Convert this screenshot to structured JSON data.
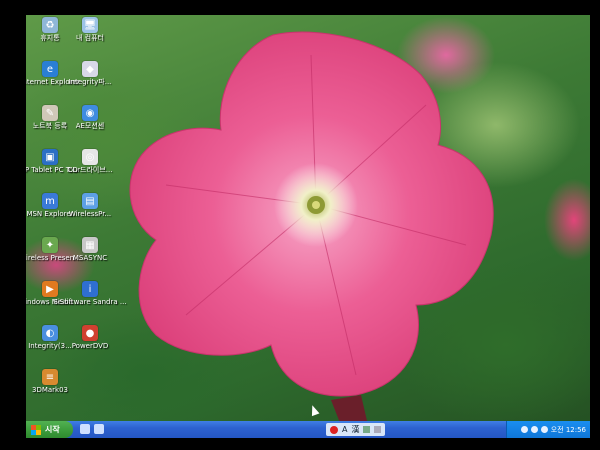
{
  "desktop": {
    "icons": [
      {
        "label": "휴지통",
        "icon": "recycle-bin-icon",
        "color": "#8fb7d8"
      },
      {
        "label": "내 컴퓨터",
        "icon": "my-computer-icon",
        "color": "#9cc3e6"
      },
      {
        "label": "Internet Explorer",
        "icon": "internet-explorer-icon",
        "color": "#2a7fd4"
      },
      {
        "label": "Integrity파...",
        "icon": "integrity-file-icon",
        "color": "#d8d8e8"
      },
      {
        "label": "노트북 등록",
        "icon": "notebook-register-icon",
        "color": "#d0c8b8"
      },
      {
        "label": "AE모션센",
        "icon": "ae-motion-sensor-icon",
        "color": "#3f8ce0"
      },
      {
        "label": "HP Tablet PC Tour",
        "icon": "hp-tablet-tour-icon",
        "color": "#2b6fc4"
      },
      {
        "label": "CD 드라이브...",
        "icon": "cd-drive-icon",
        "color": "#e6e6e6"
      },
      {
        "label": "MSN Explorer",
        "icon": "msn-explorer-icon",
        "color": "#3a7ad8"
      },
      {
        "label": "WirelessPr...",
        "icon": "wireless-pro-icon",
        "color": "#5da0e6"
      },
      {
        "label": "Wireless Presen...",
        "icon": "wireless-presentation-icon",
        "color": "#6aa84f"
      },
      {
        "label": "MSASYNC",
        "icon": "msasync-icon",
        "color": "#c8c8c8"
      },
      {
        "label": "Windows Media ...",
        "icon": "windows-media-icon",
        "color": "#e07a20"
      },
      {
        "label": "SiSoftware Sandra ...",
        "icon": "sisoftware-sandra-icon",
        "color": "#2f6fd0"
      },
      {
        "label": "Integrity(3...",
        "icon": "integrity-icon",
        "color": "#4a8fe0"
      },
      {
        "label": "PowerDVD",
        "icon": "powerdvd-icon",
        "color": "#d04030"
      },
      {
        "label": "3DMark03",
        "icon": "3dmark-icon",
        "color": "#d88a30"
      }
    ]
  },
  "taskbar": {
    "start_label": "시작",
    "lang_bar": [
      "A",
      "漢"
    ],
    "clock": "오전 12:56"
  },
  "colors": {
    "flower": "#e8457f",
    "taskbar": "#2456c3",
    "start": "#3a9a3a"
  }
}
